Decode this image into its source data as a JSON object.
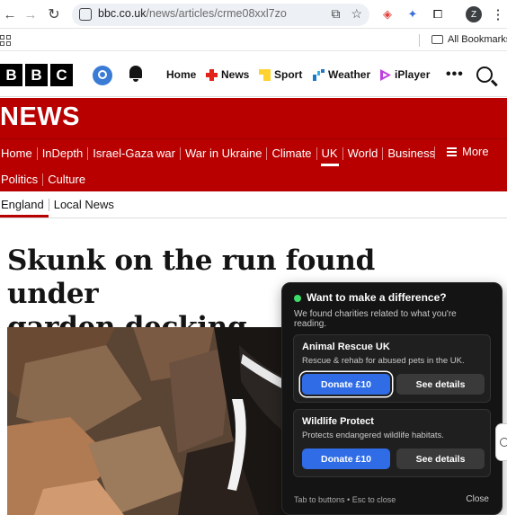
{
  "browser": {
    "url_host": "bbc.co.uk",
    "url_path": "/news/articles/crme08xxl7zo",
    "profile_initial": "Z",
    "all_bookmarks": "All Bookmarks",
    "back": "←",
    "forward": "→",
    "reload": "↻",
    "menu": "⋮"
  },
  "bbc_nav": {
    "logo": [
      "B",
      "B",
      "C"
    ],
    "items": [
      {
        "label": "Home"
      },
      {
        "label": "News",
        "color": "#e2231a"
      },
      {
        "label": "Sport",
        "color": "#ffd230"
      },
      {
        "label": "Weather",
        "color": "#1e78c8"
      },
      {
        "label": "iPlayer",
        "color": "#c03ee0"
      }
    ],
    "more": "•••"
  },
  "news_banner": {
    "title": "NEWS",
    "accent_color": "#b80000"
  },
  "section_nav": {
    "row1": [
      "Home",
      "InDepth",
      "Israel-Gaza war",
      "War in Ukraine",
      "Climate",
      "UK",
      "World",
      "Business"
    ],
    "row2": [
      "Politics",
      "Culture"
    ],
    "active": "UK",
    "more_label": "More"
  },
  "sub_nav": {
    "items": [
      "England",
      "Local News"
    ],
    "active": "England"
  },
  "article": {
    "headline_line1": "Skunk on the run found under",
    "headline_line2": "garden decking"
  },
  "popup": {
    "title": "Want to make a difference?",
    "description": "We found charities related to what you're reading.",
    "charities": [
      {
        "name": "Animal Rescue UK",
        "tagline": "Rescue & rehab for abused pets in the UK.",
        "donate_label": "Donate £10",
        "details_label": "See details"
      },
      {
        "name": "Wildlife Protect",
        "tagline": "Protects endangered wildlife habitats.",
        "donate_label": "Donate £10",
        "details_label": "See details"
      }
    ],
    "footer_hint": "Tab to buttons • Esc to close",
    "close_label": "Close",
    "status_color": "#3ddc6a"
  }
}
